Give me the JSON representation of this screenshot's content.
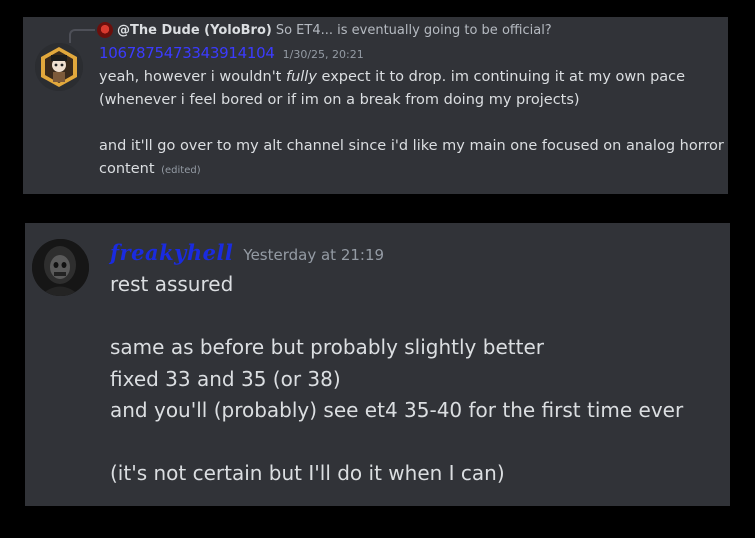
{
  "messages": [
    {
      "reply": {
        "author": "@The Dude (YoloBro)",
        "text": "So ET4... is eventually going to be official?"
      },
      "author": "1067875473343914104",
      "timestamp": "1/30/25, 20:21",
      "line1_pre": "yeah, however i wouldn't ",
      "line1_em": "fully",
      "line1_post": " expect it to drop. im continuing it at my own pace",
      "line2": "(whenever i feel bored or if im on a break from doing my projects)",
      "line3": "and it'll go over to my alt channel since i'd like my main one focused on analog horror",
      "line4": "content",
      "edited": "(edited)"
    },
    {
      "author": "freakyhell",
      "timestamp": "Yesterday at 21:19",
      "lines": [
        "rest assured",
        "",
        "same as before but probably slightly better",
        "fixed 33 and 35 (or 38)",
        "and you'll (probably) see et4 35-40 for the first time ever",
        "",
        "(it's not certain but I'll do it when I can)"
      ]
    }
  ],
  "colors": {
    "background": "#000000",
    "panel": "#313338",
    "text": "#dbdee1",
    "muted": "#949ba4",
    "username1": "#3b3bff",
    "username2": "#1a2be0"
  }
}
